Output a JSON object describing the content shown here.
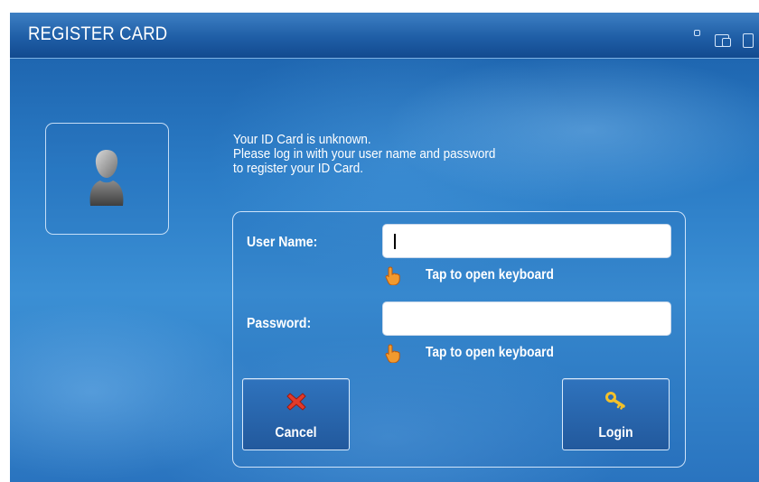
{
  "window": {
    "title": "REGISTER CARD",
    "icons": [
      "small-square-icon",
      "windows-icon",
      "window-edge-icon"
    ]
  },
  "avatar": {
    "icon": "user-silhouette-icon"
  },
  "message": {
    "line1": "Your ID Card is unknown.",
    "line2": "Please log in with your user name and password",
    "line3": "to register your ID Card."
  },
  "form": {
    "username": {
      "label": "User Name:",
      "value": "",
      "hint": "Tap to open keyboard"
    },
    "password": {
      "label": "Password:",
      "value": "",
      "hint": "Tap to open keyboard"
    }
  },
  "buttons": {
    "cancel": {
      "label": "Cancel",
      "icon": "red-x-icon",
      "color": "#e23b2a"
    },
    "login": {
      "label": "Login",
      "icon": "key-icon",
      "color": "#f3c12b"
    }
  },
  "colors": {
    "background": "#2b7cc6",
    "titlebar": "#1f5ea6",
    "text": "#ffffff"
  }
}
